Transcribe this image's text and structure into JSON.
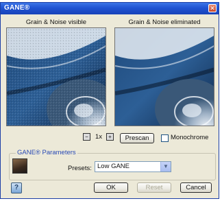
{
  "window": {
    "title": "GANE®",
    "close_glyph": "✕"
  },
  "panes": {
    "left_label": "Grain & Noise visible",
    "right_label": "Grain & Noise eliminated"
  },
  "zoom": {
    "label": "1x",
    "minus_icon": "zoom-out-icon",
    "plus_icon": "zoom-in-icon"
  },
  "prescan_button": "Prescan",
  "monochrome": {
    "label": "Monochrome",
    "checked": false
  },
  "parameters": {
    "group_title": "GANE® Parameters",
    "presets_label": "Presets:",
    "presets_value": "Low GANE"
  },
  "buttons": {
    "ok": "OK",
    "reset": "Reset",
    "cancel": "Cancel"
  },
  "colors": {
    "title_bar": "#1f53d2",
    "dialog_bg": "#ece9d8",
    "group_title": "#2748b4"
  }
}
